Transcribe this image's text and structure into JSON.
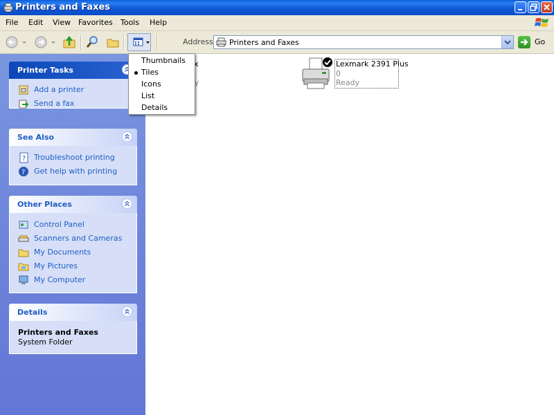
{
  "window": {
    "title": "Printers and Faxes"
  },
  "menubar": {
    "items": [
      {
        "label": "File",
        "mnemonic": "F"
      },
      {
        "label": "Edit",
        "mnemonic": "E"
      },
      {
        "label": "View",
        "mnemonic": "V"
      },
      {
        "label": "Favorites",
        "mnemonic": "a"
      },
      {
        "label": "Tools",
        "mnemonic": "T"
      },
      {
        "label": "Help",
        "mnemonic": "H"
      }
    ]
  },
  "toolbar": {
    "address_label": "Address",
    "address_value": "Printers and Faxes",
    "go_label": "Go"
  },
  "views_menu": {
    "items": [
      {
        "label": "Thumbnails",
        "selected": false
      },
      {
        "label": "Tiles",
        "selected": true
      },
      {
        "label": "Icons",
        "selected": false
      },
      {
        "label": "List",
        "selected": false
      },
      {
        "label": "Details",
        "selected": false
      }
    ]
  },
  "taskpane": {
    "printer_tasks": {
      "title": "Printer Tasks",
      "items": [
        {
          "label": "Add a printer",
          "icon": "add-printer-icon"
        },
        {
          "label": "Send a fax",
          "icon": "send-fax-icon"
        }
      ]
    },
    "see_also": {
      "title": "See Also",
      "items": [
        {
          "label": "Troubleshoot printing",
          "icon": "help-book-icon"
        },
        {
          "label": "Get help with printing",
          "icon": "help-circle-icon"
        }
      ]
    },
    "other_places": {
      "title": "Other Places",
      "items": [
        {
          "label": "Control Panel",
          "icon": "control-panel-icon"
        },
        {
          "label": "Scanners and Cameras",
          "icon": "scanner-icon"
        },
        {
          "label": "My Documents",
          "icon": "folder-icon"
        },
        {
          "label": "My Pictures",
          "icon": "pictures-folder-icon"
        },
        {
          "label": "My Computer",
          "icon": "computer-icon"
        }
      ]
    },
    "details": {
      "title": "Details",
      "name": "Printers and Faxes",
      "type": "System Folder"
    }
  },
  "printers": [
    {
      "name": "x",
      "docs": "",
      "status": "ady",
      "default": false
    },
    {
      "name": "Lexmark 2391 Plus",
      "docs": "0",
      "status": "Ready",
      "default": true
    }
  ],
  "colors": {
    "title_bar": "#0a5fd8",
    "task_link": "#215dc6",
    "taskpane_bg": "#6375d6"
  }
}
